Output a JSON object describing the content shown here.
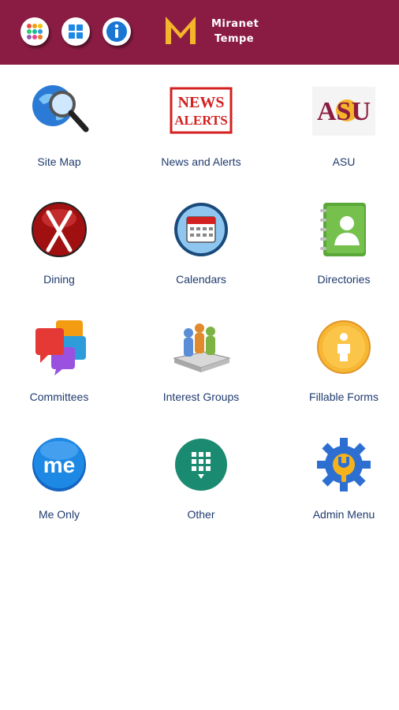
{
  "header": {
    "brand_line1": "Miranet",
    "brand_line2": "Tempe",
    "colors": {
      "bar": "#8a1c43",
      "logo_gold": "#f5b52b"
    },
    "buttons": [
      {
        "name": "apps-icon"
      },
      {
        "name": "windows-icon"
      },
      {
        "name": "info-icon"
      }
    ]
  },
  "tiles": [
    {
      "label": "Site Map",
      "icon": "globe-magnifier-icon"
    },
    {
      "label": "News and Alerts",
      "icon": "news-alerts-stamp-icon"
    },
    {
      "label": "ASU",
      "icon": "asu-logo-icon",
      "logo_text": "ASU"
    },
    {
      "label": "Dining",
      "icon": "fork-knife-icon"
    },
    {
      "label": "Calendars",
      "icon": "calendar-icon"
    },
    {
      "label": "Directories",
      "icon": "address-book-icon"
    },
    {
      "label": "Committees",
      "icon": "chat-bubbles-icon"
    },
    {
      "label": "Interest Groups",
      "icon": "people-puzzle-icon"
    },
    {
      "label": "Fillable Forms",
      "icon": "person-badge-icon"
    },
    {
      "label": "Me Only",
      "icon": "me-icon",
      "logo_text": "me"
    },
    {
      "label": "Other",
      "icon": "app-grid-icon"
    },
    {
      "label": "Admin Menu",
      "icon": "gear-wrench-icon"
    }
  ],
  "stamp_text": {
    "line1": "NEWS",
    "line2": "ALERTS"
  }
}
